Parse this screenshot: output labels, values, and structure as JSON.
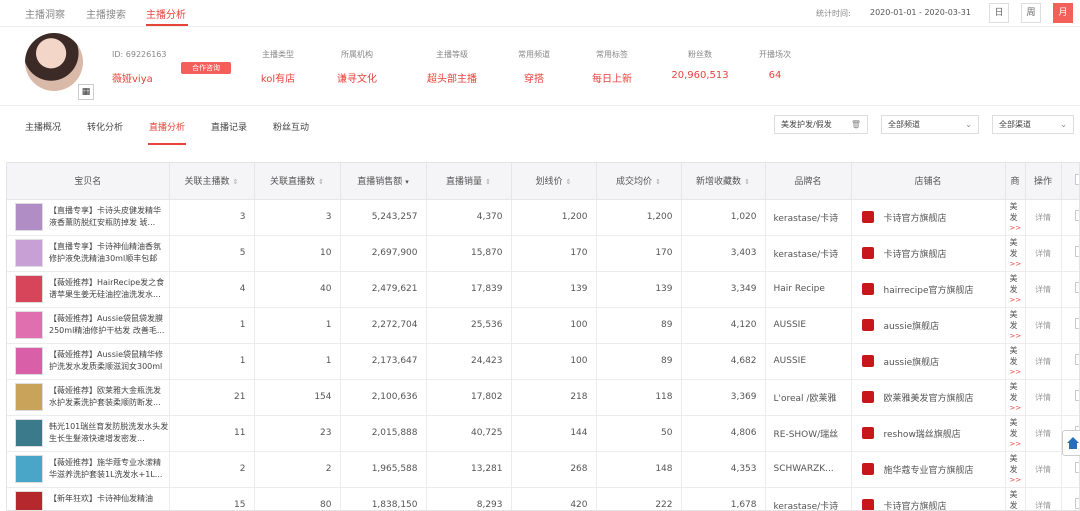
{
  "topnav": {
    "tabs": [
      "主播洞察",
      "主播搜索",
      "主播分析"
    ],
    "active_index": 2,
    "stat_label": "统计时间:",
    "stat_range": "2020-01-01 - 2020-03-31",
    "periods": [
      "日",
      "周",
      "月"
    ],
    "active_period": "月"
  },
  "profile": {
    "id_text": "ID: 69226163",
    "name": "薇娅viya",
    "coop_button": "合作咨询",
    "qr_icon": "qr-code-icon",
    "info": [
      {
        "label": "主播类型",
        "value": "kol有店"
      },
      {
        "label": "所属机构",
        "value": "谦寻文化"
      },
      {
        "label": "主播等级",
        "value": "超头部主播"
      },
      {
        "label": "常用频道",
        "value": "穿搭"
      },
      {
        "label": "常用标签",
        "value": "每日上新"
      },
      {
        "label": "粉丝数",
        "value": "20,960,513"
      },
      {
        "label": "开播场次",
        "value": "64"
      }
    ]
  },
  "subtabs": {
    "items": [
      "主播概况",
      "转化分析",
      "直播分析",
      "直播记录",
      "粉丝互动"
    ],
    "active_index": 2
  },
  "filters": {
    "category": "美发护发/假发",
    "channel": "全部频道",
    "all_channels": "全部渠道"
  },
  "table": {
    "headers": {
      "product": "宝贝名",
      "linked_anchors": "关联主播数",
      "linked_lives": "关联直播数",
      "live_sales_amount": "直播销售额",
      "live_sales_volume": "直播销量",
      "list_price": "划线价",
      "avg_deal_price": "成交均价",
      "new_favorites": "新增收藏数",
      "brand": "品牌名",
      "shop": "店铺名",
      "cut_col": "商",
      "action": "操作"
    },
    "rows": [
      {
        "title": "【直播专享】卡诗头皮健发精华液香薰防脱红安瓶防掉发 琥...",
        "anchors": "3",
        "lives": "3",
        "amount": "5,243,257",
        "volume": "4,370",
        "list_price": "1,200",
        "avg_price": "1,200",
        "fav": "1,020",
        "brand": "kerastase/卡诗",
        "shop": "卡诗官方旗舰店",
        "cut": "美发",
        "cut_link": ">>",
        "action": "详情",
        "thumb_color": "#b08dc4"
      },
      {
        "title": "【直播专享】卡诗神仙精油香氛修护液免洗精油30ml顺丰包邮",
        "anchors": "5",
        "lives": "10",
        "amount": "2,697,900",
        "volume": "15,870",
        "list_price": "170",
        "avg_price": "170",
        "fav": "3,403",
        "brand": "kerastase/卡诗",
        "shop": "卡诗官方旗舰店",
        "cut": "美发",
        "cut_link": ">>",
        "action": "详情",
        "thumb_color": "#c9a0d6"
      },
      {
        "title": "【薇娅推荐】HairRecipe发之食谱苹果生姜无硅油控油洗发水...",
        "anchors": "4",
        "lives": "40",
        "amount": "2,479,621",
        "volume": "17,839",
        "list_price": "139",
        "avg_price": "139",
        "fav": "3,349",
        "brand": "Hair Recipe",
        "shop": "hairrecipe官方旗舰店",
        "cut": "美发",
        "cut_link": ">>",
        "action": "详情",
        "thumb_color": "#d7455a"
      },
      {
        "title": "【薇娅推荐】Aussie袋鼠袋发膜250ml精油修护干枯发 改善毛...",
        "anchors": "1",
        "lives": "1",
        "amount": "2,272,704",
        "volume": "25,536",
        "list_price": "100",
        "avg_price": "89",
        "fav": "4,120",
        "brand": "AUSSIE",
        "shop": "aussie旗舰店",
        "cut": "美发",
        "cut_link": ">>",
        "action": "详情",
        "thumb_color": "#e06fb0"
      },
      {
        "title": "【薇娅推荐】Aussie袋鼠精华修护洗发水发质柔顺滋润女300ml",
        "anchors": "1",
        "lives": "1",
        "amount": "2,173,647",
        "volume": "24,423",
        "list_price": "100",
        "avg_price": "89",
        "fav": "4,682",
        "brand": "AUSSIE",
        "shop": "aussie旗舰店",
        "cut": "美发",
        "cut_link": ">>",
        "action": "详情",
        "thumb_color": "#d95fa8"
      },
      {
        "title": "【薇娅推荐】欧莱雅大金瓶洗发水护发素洗护套装柔顺防断发...",
        "anchors": "21",
        "lives": "154",
        "amount": "2,100,636",
        "volume": "17,802",
        "list_price": "218",
        "avg_price": "118",
        "fav": "3,369",
        "brand": "L'oreal /欧莱雅",
        "shop": "欧莱雅美发官方旗舰店",
        "cut": "美发",
        "cut_link": ">>",
        "action": "详情",
        "thumb_color": "#c9a35a"
      },
      {
        "title": "韩光101瑞丝育发防脱洗发水头发生长生髮液快速增发密发...",
        "anchors": "11",
        "lives": "23",
        "amount": "2,015,888",
        "volume": "40,725",
        "list_price": "144",
        "avg_price": "50",
        "fav": "4,806",
        "brand": "RE-SHOW/瑞丝",
        "shop": "reshow瑞丝旗舰店",
        "cut": "美发",
        "cut_link": ">>",
        "action": "详情",
        "thumb_color": "#3a7a8a"
      },
      {
        "title": "【薇娅推荐】施华蔻专业水潆精华滋养洗护套装1L洗发水+1L...",
        "anchors": "2",
        "lives": "2",
        "amount": "1,965,588",
        "volume": "13,281",
        "list_price": "268",
        "avg_price": "148",
        "fav": "4,353",
        "brand": "SCHWARZK...",
        "shop": "施华蔻专业官方旗舰店",
        "cut": "美发",
        "cut_link": ">>",
        "action": "详情",
        "thumb_color": "#4aa6c8"
      },
      {
        "title": "【新年狂欢】卡诗神仙发精油",
        "anchors": "15",
        "lives": "80",
        "amount": "1,838,150",
        "volume": "8,293",
        "list_price": "420",
        "avg_price": "222",
        "fav": "1,678",
        "brand": "kerastase/卡诗",
        "shop": "卡诗官方旗舰店",
        "cut": "美发",
        "cut_link": ">>",
        "action": "详情",
        "thumb_color": "#b5282e"
      }
    ]
  },
  "home_icon": "home-icon"
}
